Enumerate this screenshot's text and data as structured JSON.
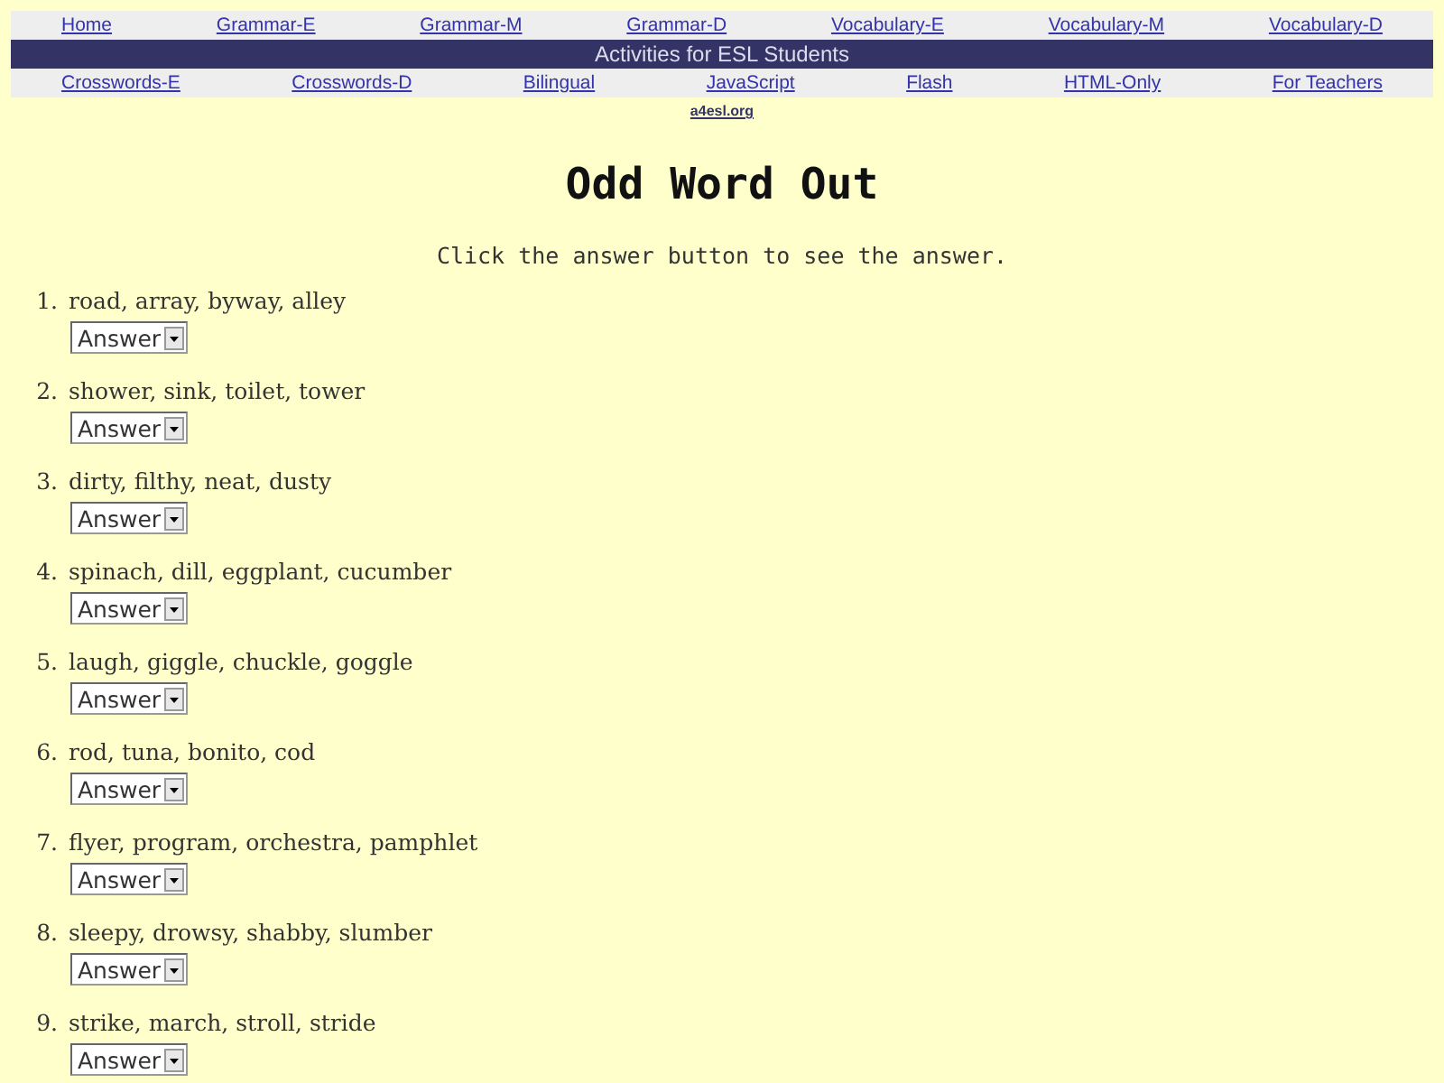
{
  "nav_top": [
    "Home",
    "Grammar-E",
    "Grammar-M",
    "Grammar-D",
    "Vocabulary-E",
    "Vocabulary-M",
    "Vocabulary-D"
  ],
  "banner": "Activities for ESL Students",
  "nav_bottom": [
    "Crosswords-E",
    "Crosswords-D",
    "Bilingual",
    "JavaScript",
    "Flash",
    "HTML-Only",
    "For Teachers"
  ],
  "site_link": "a4esl.org",
  "title": "Odd Word Out",
  "instructions": "Click the answer button to see the answer.",
  "questions": [
    {
      "number": "1.",
      "words": "road, array, byway, alley",
      "answer": "Answer"
    },
    {
      "number": "2.",
      "words": "shower, sink, toilet, tower",
      "answer": "Answer"
    },
    {
      "number": "3.",
      "words": "dirty, filthy, neat, dusty",
      "answer": "Answer"
    },
    {
      "number": "4.",
      "words": "spinach, dill, eggplant, cucumber",
      "answer": "Answer"
    },
    {
      "number": "5.",
      "words": "laugh, giggle, chuckle, goggle",
      "answer": "Answer"
    },
    {
      "number": "6.",
      "words": "rod, tuna, bonito, cod",
      "answer": "Answer"
    },
    {
      "number": "7.",
      "words": "flyer, program, orchestra, pamphlet",
      "answer": "Answer"
    },
    {
      "number": "8.",
      "words": "sleepy, drowsy, shabby, slumber",
      "answer": "Answer"
    },
    {
      "number": "9.",
      "words": "strike, march, stroll, stride",
      "answer": "Answer"
    }
  ]
}
